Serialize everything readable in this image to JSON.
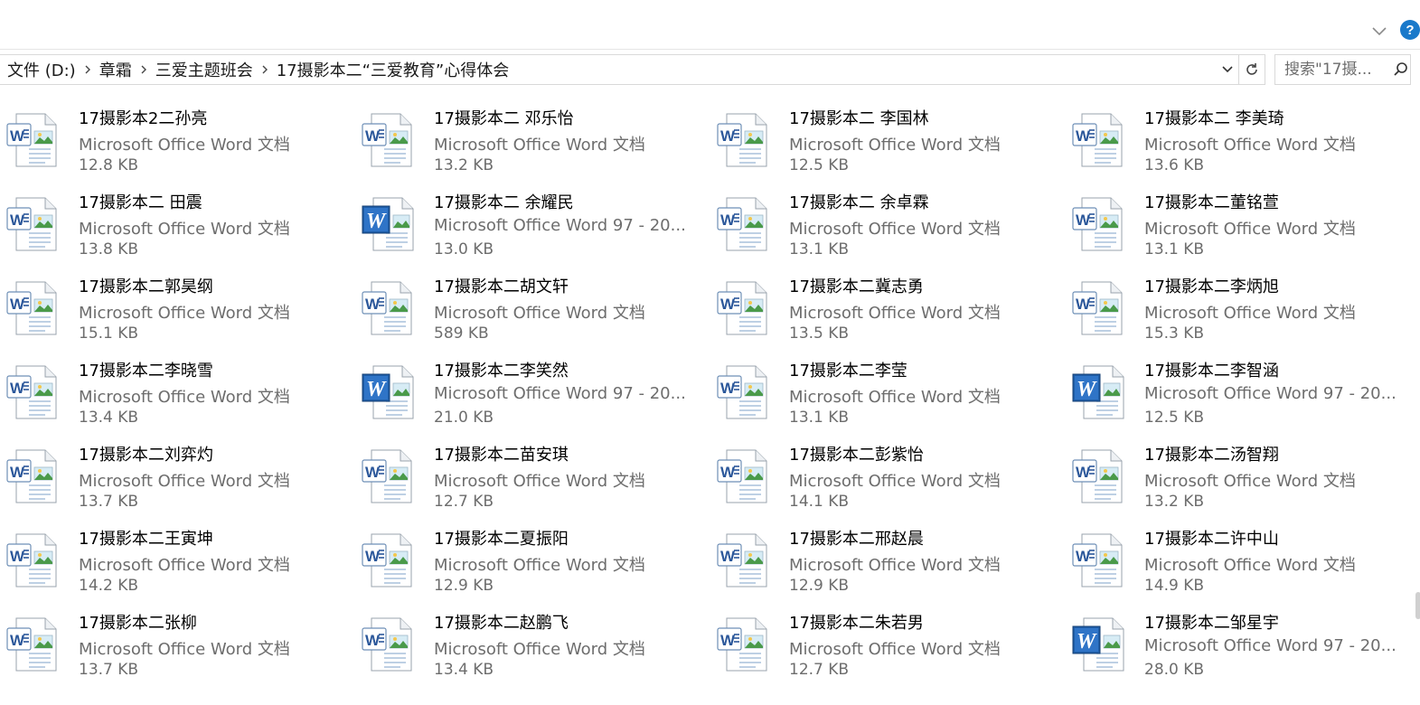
{
  "window": {
    "cut_title": ""
  },
  "address": {
    "crumbs": [
      "文件 (D:)",
      "章霜",
      "三爱主题班会",
      "17摄影本二“三爱教育”心得体会"
    ]
  },
  "search": {
    "placeholder": "搜索\"17摄..."
  },
  "files": [
    {
      "name": "17摄影本2二孙亮",
      "type": "Microsoft Office Word 文档",
      "size": "12.8 KB",
      "icon": "docx-icon"
    },
    {
      "name": "17摄影本二 邓乐怡",
      "type": "Microsoft Office Word 文档",
      "size": "13.2 KB",
      "icon": "docx-icon"
    },
    {
      "name": "17摄影本二 李国林",
      "type": "Microsoft Office Word 文档",
      "size": "12.5 KB",
      "icon": "docx-icon"
    },
    {
      "name": "17摄影本二 李美琦",
      "type": "Microsoft Office Word 文档",
      "size": "13.6 KB",
      "icon": "docx-icon"
    },
    {
      "name": "17摄影本二 田震",
      "type": "Microsoft Office Word 文档",
      "size": "13.8 KB",
      "icon": "docx-icon"
    },
    {
      "name": "17摄影本二 余耀民",
      "type": "Microsoft Office Word 97 - 20...",
      "size": "13.0 KB",
      "icon": "doc-icon"
    },
    {
      "name": "17摄影本二 余卓霖",
      "type": "Microsoft Office Word 文档",
      "size": "13.1 KB",
      "icon": "docx-icon"
    },
    {
      "name": "17摄影本二董铭萱",
      "type": "Microsoft Office Word 文档",
      "size": "13.1 KB",
      "icon": "docx-icon"
    },
    {
      "name": "17摄影本二郭昊纲",
      "type": "Microsoft Office Word 文档",
      "size": "15.1 KB",
      "icon": "docx-icon"
    },
    {
      "name": "17摄影本二胡文轩",
      "type": "Microsoft Office Word 文档",
      "size": "589 KB",
      "icon": "docx-icon"
    },
    {
      "name": "17摄影本二冀志勇",
      "type": "Microsoft Office Word 文档",
      "size": "13.5 KB",
      "icon": "docx-icon"
    },
    {
      "name": "17摄影本二李炳旭",
      "type": "Microsoft Office Word 文档",
      "size": "15.3 KB",
      "icon": "docx-icon"
    },
    {
      "name": "17摄影本二李晓雪",
      "type": "Microsoft Office Word 文档",
      "size": "13.4 KB",
      "icon": "docx-icon"
    },
    {
      "name": "17摄影本二李笑然",
      "type": "Microsoft Office Word 97 - 20...",
      "size": "21.0 KB",
      "icon": "doc-icon"
    },
    {
      "name": "17摄影本二李莹",
      "type": "Microsoft Office Word 文档",
      "size": "13.1 KB",
      "icon": "docx-icon"
    },
    {
      "name": "17摄影本二李智涵",
      "type": "Microsoft Office Word 97 - 20...",
      "size": "12.5 KB",
      "icon": "doc-icon"
    },
    {
      "name": "17摄影本二刘弈灼",
      "type": "Microsoft Office Word 文档",
      "size": "13.7 KB",
      "icon": "docx-icon"
    },
    {
      "name": "17摄影本二苗安琪",
      "type": "Microsoft Office Word 文档",
      "size": "12.7 KB",
      "icon": "docx-icon"
    },
    {
      "name": "17摄影本二彭紫怡",
      "type": "Microsoft Office Word 文档",
      "size": "14.1 KB",
      "icon": "docx-icon"
    },
    {
      "name": "17摄影本二汤智翔",
      "type": "Microsoft Office Word 文档",
      "size": "13.2 KB",
      "icon": "docx-icon"
    },
    {
      "name": "17摄影本二王寅坤",
      "type": "Microsoft Office Word 文档",
      "size": "14.2 KB",
      "icon": "docx-icon"
    },
    {
      "name": "17摄影本二夏振阳",
      "type": "Microsoft Office Word 文档",
      "size": "12.9 KB",
      "icon": "docx-icon"
    },
    {
      "name": "17摄影本二邢赵晨",
      "type": "Microsoft Office Word 文档",
      "size": "12.9 KB",
      "icon": "docx-icon"
    },
    {
      "name": "17摄影本二许中山",
      "type": "Microsoft Office Word 文档",
      "size": "14.9 KB",
      "icon": "docx-icon"
    },
    {
      "name": "17摄影本二张柳",
      "type": "Microsoft Office Word 文档",
      "size": "13.7 KB",
      "icon": "docx-icon"
    },
    {
      "name": "17摄影本二赵鹏飞",
      "type": "Microsoft Office Word 文档",
      "size": "13.4 KB",
      "icon": "docx-icon"
    },
    {
      "name": "17摄影本二朱若男",
      "type": "Microsoft Office Word 文档",
      "size": "12.7 KB",
      "icon": "docx-icon"
    },
    {
      "name": "17摄影本二邹星宇",
      "type": "Microsoft Office Word 97 - 20...",
      "size": "28.0 KB",
      "icon": "doc-icon"
    }
  ],
  "colors": {
    "accent": "#1979ca",
    "secondary_text": "#6d6d6d",
    "border": "#d9d9d9"
  }
}
